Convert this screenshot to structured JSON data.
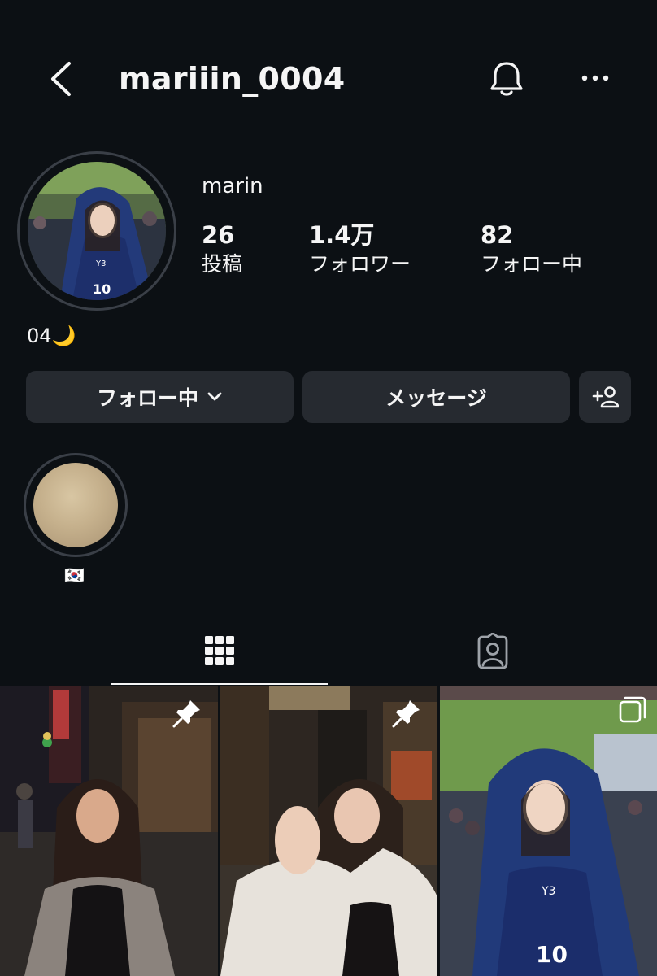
{
  "header": {
    "username": "mariiin_0004",
    "icons": {
      "back": "chevron-left-icon",
      "notifications": "bell-icon",
      "more": "more-horizontal-icon"
    }
  },
  "profile": {
    "display_name": "marin",
    "stats": [
      {
        "value": "26",
        "label": "投稿"
      },
      {
        "value": "1.4万",
        "label": "フォロワー"
      },
      {
        "value": "82",
        "label": "フォロー中"
      }
    ],
    "bio": "04🌙"
  },
  "actions": {
    "following_label": "フォロー中",
    "message_label": "メッセージ",
    "icons": {
      "following_menu": "chevron-down-icon",
      "suggest": "add-person-icon"
    }
  },
  "highlights": [
    {
      "label": "🇰🇷"
    }
  ],
  "tabs": [
    {
      "name": "posts",
      "icon": "grid-icon",
      "active": true
    },
    {
      "name": "tagged",
      "icon": "tagged-person-icon",
      "active": false
    }
  ],
  "posts": [
    {
      "badge_icon": "pin-icon"
    },
    {
      "badge_icon": "pin-icon"
    },
    {
      "badge_icon": "multiple-posts-icon"
    }
  ],
  "colors": {
    "background": "#0c1014",
    "button": "#262a30",
    "ring": "#3a3f47",
    "text": "#f5f5f5"
  }
}
